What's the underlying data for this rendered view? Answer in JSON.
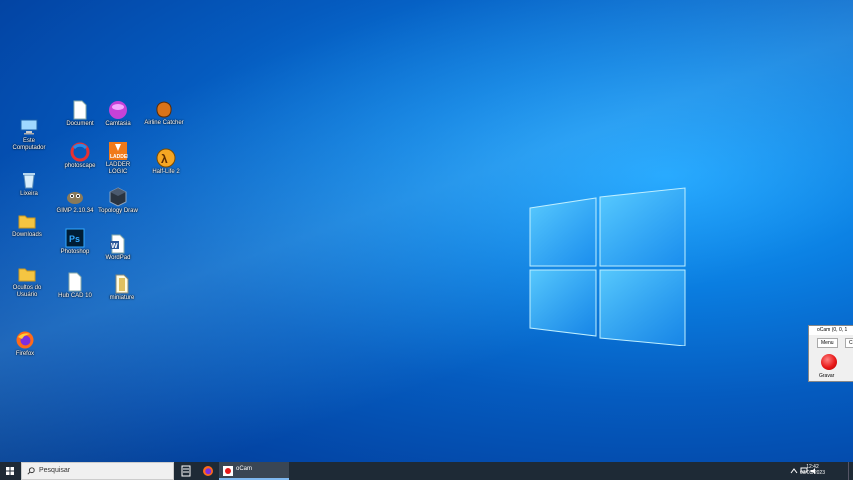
{
  "desktop": {
    "icons": [
      {
        "label": "Este Computador",
        "icon": "computer-icon"
      },
      {
        "label": "Lixeira",
        "icon": "recycle-bin-icon"
      },
      {
        "label": "Downloads",
        "icon": "folder-icon"
      },
      {
        "label": "Ocultos do Usuário",
        "icon": "folder-icon"
      },
      {
        "label": "Firefox",
        "icon": "firefox-icon"
      },
      {
        "label": "Document",
        "icon": "file-icon"
      },
      {
        "label": "photoscape",
        "icon": "photoscape-icon"
      },
      {
        "label": "GIMP 2.10.34",
        "icon": "gimp-icon"
      },
      {
        "label": "Photoshop",
        "icon": "photoshop-icon"
      },
      {
        "label": "Hub CAD 10",
        "icon": "file-icon"
      },
      {
        "label": "Camtasia",
        "icon": "camtasia-icon"
      },
      {
        "label": "LADDER LOGIC",
        "icon": "ladder-icon"
      },
      {
        "label": "Topology Draw",
        "icon": "cube-icon"
      },
      {
        "label": "WordPad",
        "icon": "word-icon"
      },
      {
        "label": "miniature",
        "icon": "file-icon"
      },
      {
        "label": "Airline Catcher",
        "icon": "glove-icon"
      },
      {
        "label": "Half-Life 2",
        "icon": "half-life-icon"
      }
    ]
  },
  "taskbar": {
    "search_placeholder": "Pesquisar",
    "running_app": "oCam",
    "clock_time": "12:42",
    "clock_date": "07/05/2023"
  },
  "ocam_window": {
    "title": "oCam (0, 0, 1",
    "tabs": [
      "Menu",
      "Cr"
    ],
    "record_label": "Gravar",
    "record_color": "#e81919"
  },
  "colors": {
    "taskbar": "#1e2a36",
    "accent": "#7fb8f0"
  }
}
